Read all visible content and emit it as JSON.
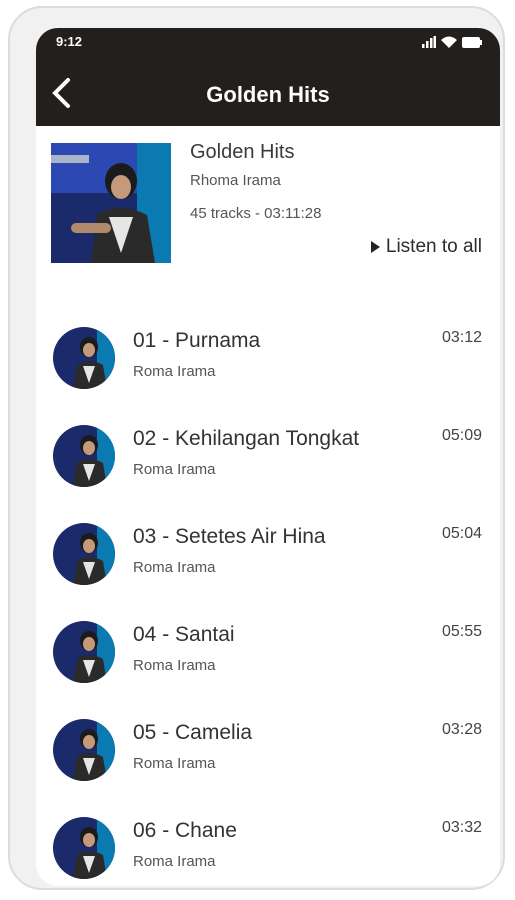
{
  "status": {
    "time": "9:12"
  },
  "appbar": {
    "title": "Golden Hits",
    "back_icon": "chevron-left-icon"
  },
  "album": {
    "title": "Golden Hits",
    "artist": "Rhoma Irama",
    "meta": "45 tracks - 03:11:28",
    "listen_label": "Listen to all"
  },
  "tracks": [
    {
      "title": "01 - Purnama",
      "artist": "Roma Irama",
      "duration": "03:12"
    },
    {
      "title": "02 - Kehilangan Tongkat",
      "artist": "Roma Irama",
      "duration": "05:09"
    },
    {
      "title": "03 - Setetes Air Hina",
      "artist": "Roma Irama",
      "duration": "05:04"
    },
    {
      "title": "04 - Santai",
      "artist": "Roma Irama",
      "duration": "05:55"
    },
    {
      "title": "05 - Camelia",
      "artist": "Roma Irama",
      "duration": "03:28"
    },
    {
      "title": "06 - Chane",
      "artist": "Roma Irama",
      "duration": "03:32"
    }
  ],
  "colors": {
    "bar": "#231f1d",
    "accent_cover": "#1e3a8a"
  }
}
